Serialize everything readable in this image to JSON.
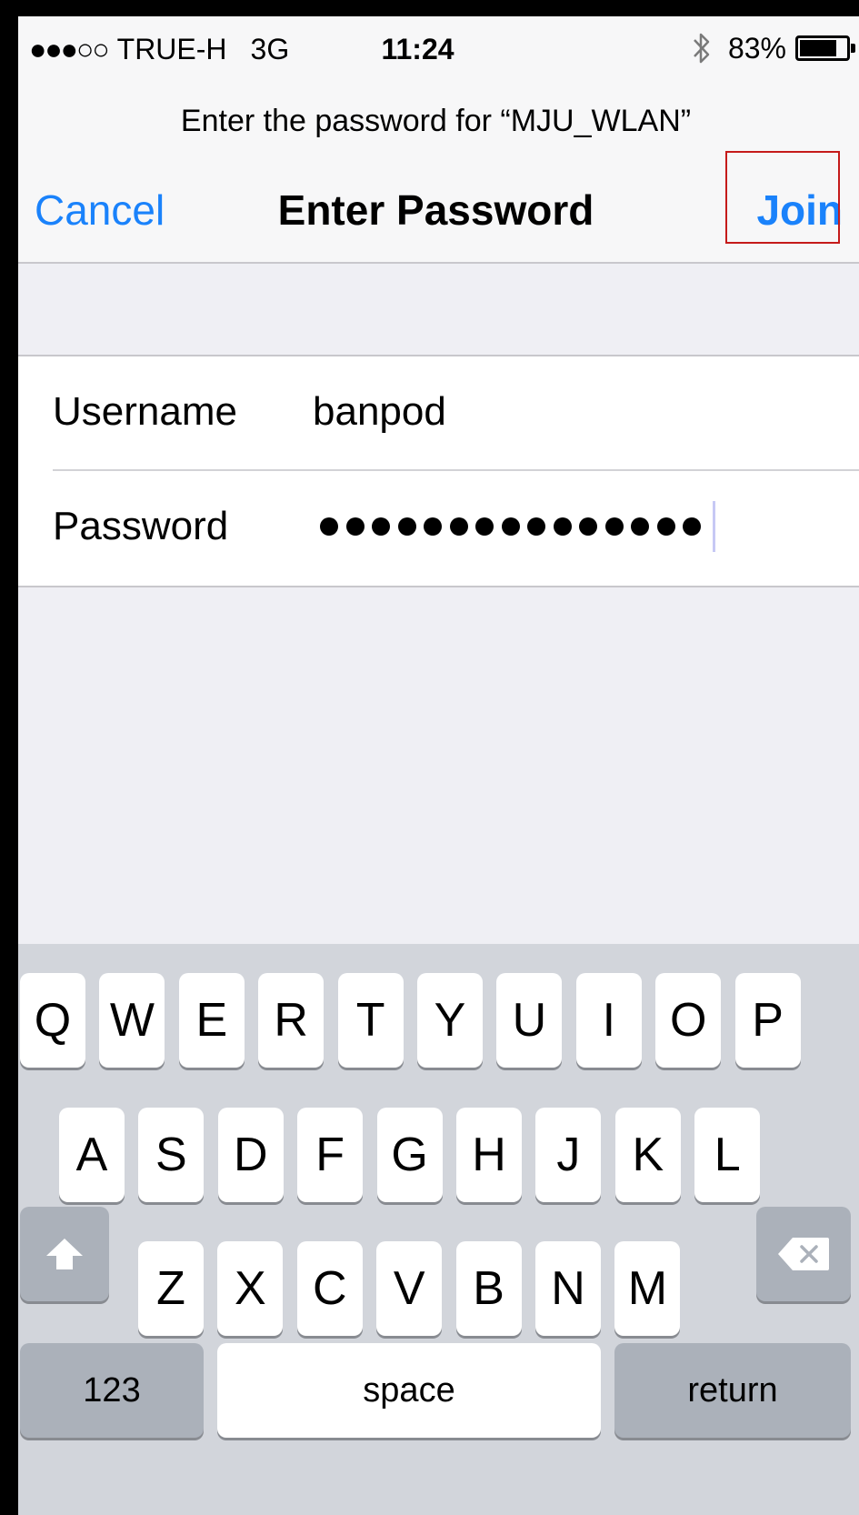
{
  "status_bar": {
    "signal": "●●●○○",
    "carrier": "TRUE-H",
    "network": "3G",
    "time": "11:24",
    "battery_percent": "83%",
    "battery_level": 0.83,
    "bluetooth_icon": "bluetooth-icon"
  },
  "prompt": "Enter the password for “MJU_WLAN”",
  "nav": {
    "cancel_label": "Cancel",
    "title": "Enter Password",
    "join_label": "Join",
    "join_highlight_color": "#c51a1a"
  },
  "form": {
    "username_label": "Username",
    "username_value": "banpod",
    "password_label": "Password",
    "password_mask_count": 15
  },
  "keyboard": {
    "row1": [
      "Q",
      "W",
      "E",
      "R",
      "T",
      "Y",
      "U",
      "I",
      "O",
      "P"
    ],
    "row2": [
      "A",
      "S",
      "D",
      "F",
      "G",
      "H",
      "J",
      "K",
      "L"
    ],
    "row3": [
      "Z",
      "X",
      "C",
      "V",
      "B",
      "N",
      "M"
    ],
    "shift_icon": "shift-arrow-icon",
    "delete_icon": "backspace-icon",
    "numbers_label": "123",
    "space_label": "space",
    "return_label": "return"
  },
  "colors": {
    "accent": "#1a82fb",
    "background": "#efeff4",
    "keyboard_bg": "#d2d5db"
  }
}
